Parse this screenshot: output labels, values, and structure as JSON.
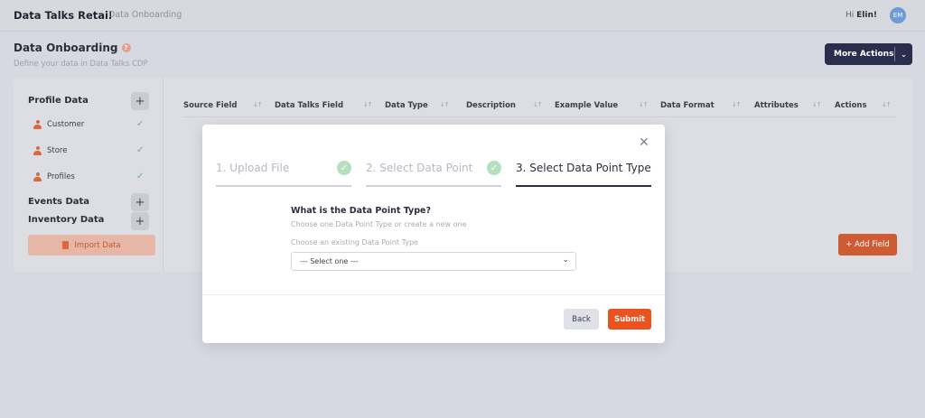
{
  "app": {
    "title": "Data Talks Retail",
    "breadcrumb": "Data Onboarding"
  },
  "user": {
    "greeting": "Hi ",
    "name": "Elin!",
    "initials": "EM"
  },
  "page": {
    "title": "Data Onboarding",
    "subtitle": "Define your data in Data Talks CDP",
    "more_actions": "More Actions"
  },
  "sidebar": {
    "profile_heading": "Profile Data",
    "profile_items": [
      {
        "label": "Customer",
        "icon": "person-icon",
        "status": "check-icon"
      },
      {
        "label": "Store",
        "icon": "person-icon",
        "status": "check-icon"
      },
      {
        "label": "Profiles",
        "icon": "person-icon",
        "status": "check-icon"
      }
    ],
    "events_heading": "Events Data",
    "inventory_heading": "Inventory Data",
    "import_label": "Import Data",
    "add_symbol": "+"
  },
  "table": {
    "columns": [
      "Source Field",
      "Data Talks Field",
      "Data Type",
      "Description",
      "Example Value",
      "Data Format",
      "Attributes",
      "Actions"
    ],
    "add_field": "+ Add Field"
  },
  "modal": {
    "steps": [
      {
        "label": "1. Upload File",
        "done": true
      },
      {
        "label": "2. Select Data Point",
        "done": true
      },
      {
        "label": "3. Select Data Point Type",
        "done": false,
        "active": true
      }
    ],
    "question": "What is the Data Point Type?",
    "question_sub": "Choose one Data Point Type or create a new one",
    "select_label": "Choose an existing Data Point Type",
    "select_value": "--- Select one ---",
    "back": "Back",
    "submit": "Submit"
  },
  "colors": {
    "accent": "#e8531e",
    "navy": "#2b2d4d",
    "success": "#6bb07d"
  }
}
